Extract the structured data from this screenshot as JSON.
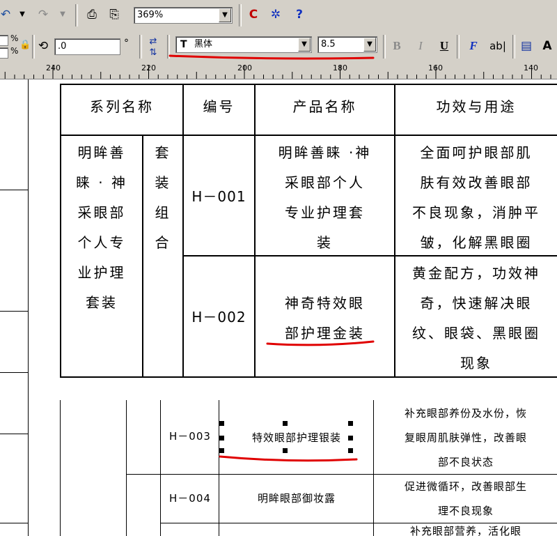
{
  "toolbar1": {
    "undo_icon": "undo-icon",
    "redo_icon": "redo-icon",
    "zoom_value": "369%",
    "zoom_dropdown_icon": "chevron-down-icon"
  },
  "toolbar2": {
    "pct_label_top": "%",
    "pct_label_bottom": "%",
    "rotation_value": ".0",
    "degree_symbol": "°",
    "font_name": "黑体",
    "font_size": "8.5",
    "bold_label": "B",
    "italic_label": "I",
    "underline_label": "U",
    "f_label": "F",
    "ab_label": "ab|"
  },
  "ruler": {
    "labels": [
      "240",
      "220",
      "200",
      "180",
      "160",
      "140"
    ]
  },
  "table": {
    "headers": [
      "系列名称",
      "编号",
      "产品名称",
      "功效与用途"
    ],
    "series_name_lines": [
      "明眸善",
      "睐 · 神",
      "采眼部",
      "个人专",
      "业护理",
      "套装"
    ],
    "series_type_lines": [
      "套",
      "装",
      "组",
      "合"
    ],
    "rows": [
      {
        "code": "H－001",
        "product_lines": [
          "明眸善睐 ·神",
          "采眼部个人",
          "专业护理套",
          "装"
        ],
        "effect_lines": [
          "全面呵护眼部肌",
          "肤有效改善眼部",
          "不良现象，消肿平",
          "皱，化解黑眼圈"
        ]
      },
      {
        "code": "H－002",
        "product_lines": [
          "神奇特效眼",
          "部护理金装"
        ],
        "effect_lines": [
          "黄金配方，功效神",
          "奇，快速解决眼",
          "纹、眼袋、黑眼圈",
          "现象"
        ]
      }
    ]
  },
  "table2": {
    "rows": [
      {
        "code": "H－003",
        "product": "特效眼部护理银装",
        "effect_lines": [
          "补充眼部养份及水份，恢",
          "复眼周肌肤弹性，改善眼",
          "部不良状态"
        ]
      },
      {
        "code": "H－004",
        "product": "明眸眼部御妆露",
        "effect_lines": [
          "促进微循环，改善眼部生",
          "理不良现象"
        ]
      }
    ],
    "partial_text": "补充眼部营养，活化眼"
  }
}
